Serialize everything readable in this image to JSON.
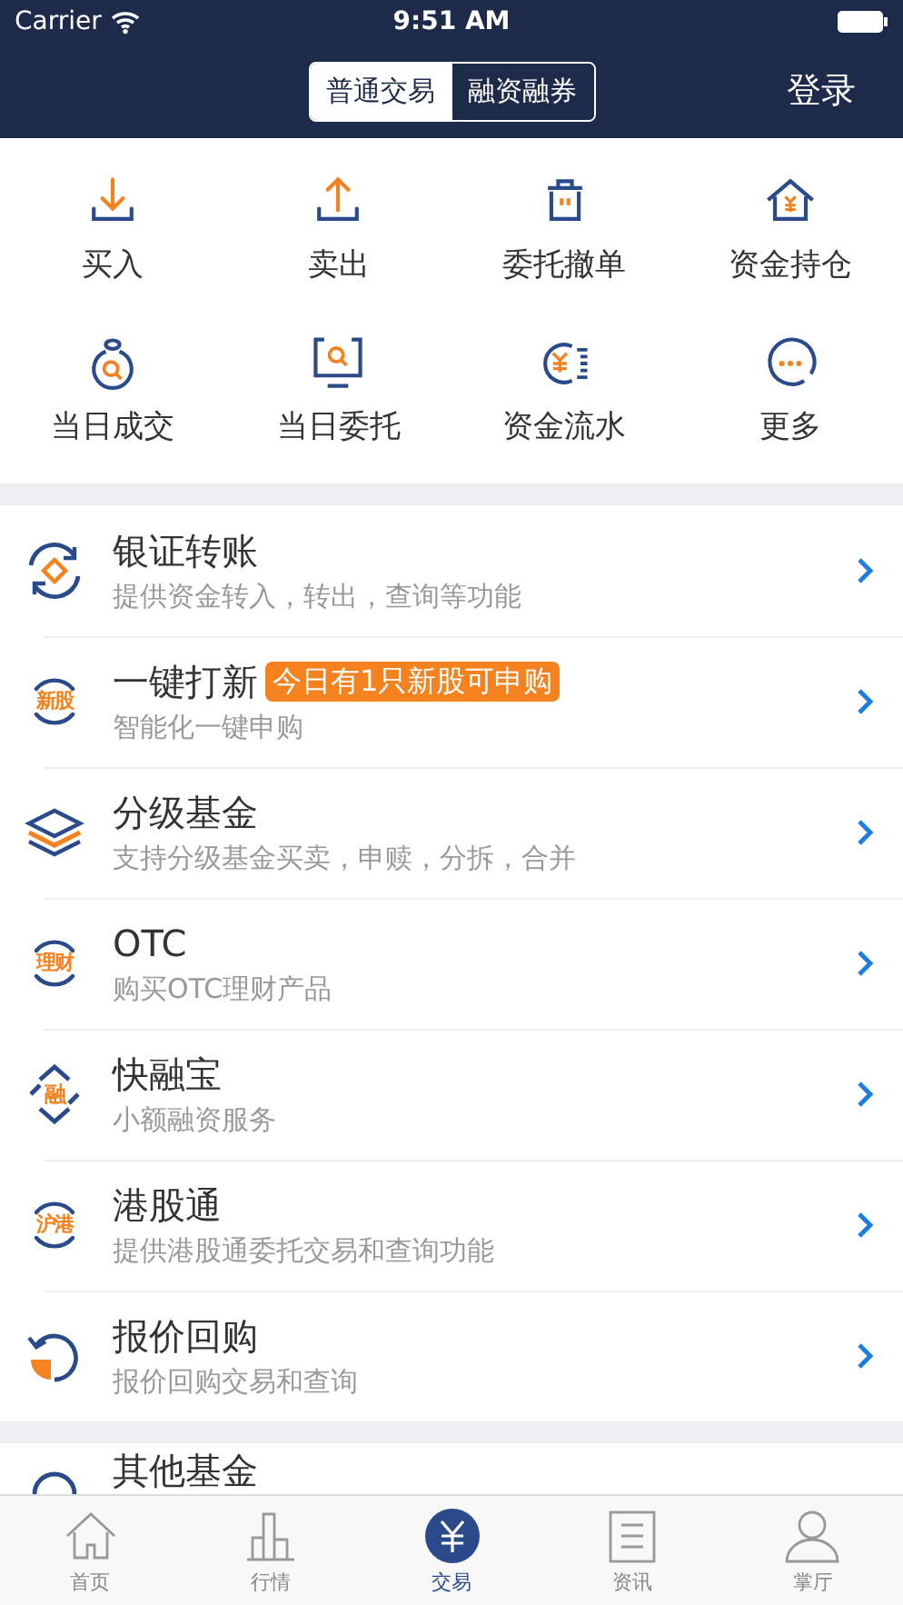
{
  "status_bar": {
    "carrier": "Carrier",
    "time": "9:51 AM"
  },
  "nav": {
    "segments": [
      {
        "label": "普通交易",
        "selected": true
      },
      {
        "label": "融资融券",
        "selected": false
      }
    ],
    "action": "登录"
  },
  "quick_actions": [
    {
      "kind": "download",
      "label": "买入"
    },
    {
      "kind": "upload",
      "label": "卖出"
    },
    {
      "kind": "trash",
      "label": "委托撤单"
    },
    {
      "kind": "house",
      "label": "资金持仓"
    },
    {
      "kind": "bag",
      "label": "当日成交"
    },
    {
      "kind": "monitor",
      "label": "当日委托"
    },
    {
      "kind": "coin",
      "label": "资金流水"
    },
    {
      "kind": "more",
      "label": "更多"
    }
  ],
  "services": [
    {
      "kind": "swap",
      "title": "银证转账",
      "subtitle": "提供资金转入，转出，查询等功能"
    },
    {
      "kind": "text",
      "icon_text": "新股",
      "title": "一键打新",
      "badge": "今日有1只新股可申购",
      "subtitle": "智能化一键申购"
    },
    {
      "kind": "layers",
      "title": "分级基金",
      "subtitle": "支持分级基金买卖，申赎，分拆，合并"
    },
    {
      "kind": "text",
      "icon_text": "理财",
      "title": "OTC",
      "subtitle": "购买OTC理财产品"
    },
    {
      "kind": "diamond",
      "icon_text": "融",
      "title": "快融宝",
      "subtitle": "小额融资服务"
    },
    {
      "kind": "text",
      "icon_text": "沪港",
      "title": "港股通",
      "subtitle": "提供港股通委托交易和查询功能"
    },
    {
      "kind": "refresh",
      "title": "报价回购",
      "subtitle": "报价回购交易和查询"
    }
  ],
  "more_services": [
    {
      "kind": "partial",
      "title": "其他基金"
    }
  ],
  "tab_bar": [
    {
      "kind": "home",
      "label": "首页",
      "selected": false
    },
    {
      "kind": "chart",
      "label": "行情",
      "selected": false
    },
    {
      "kind": "yen",
      "label": "交易",
      "selected": true
    },
    {
      "kind": "doc",
      "label": "资讯",
      "selected": false
    },
    {
      "kind": "person",
      "label": "掌厅",
      "selected": false
    }
  ]
}
